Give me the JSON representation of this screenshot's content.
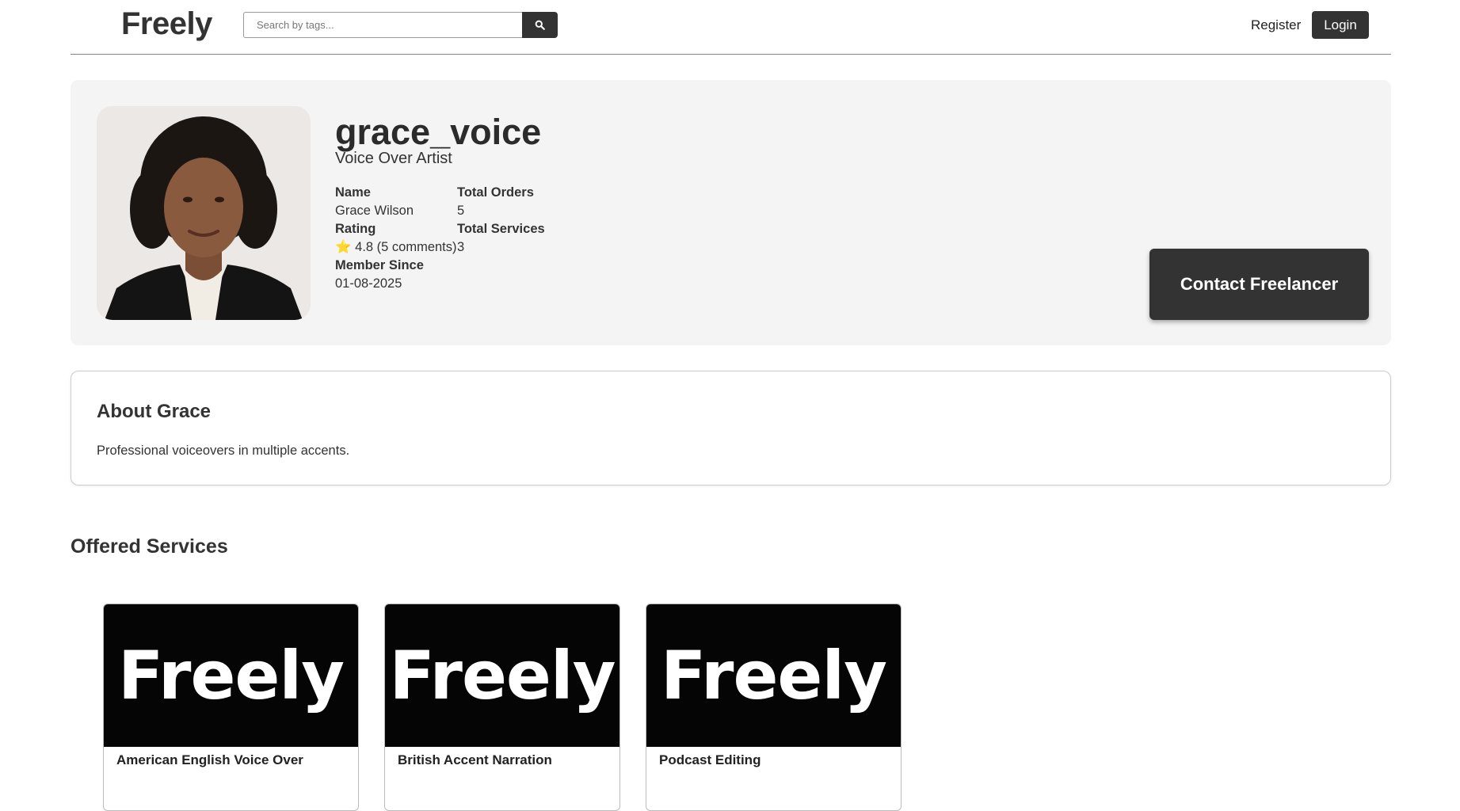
{
  "header": {
    "logo": "Freely",
    "search_placeholder": "Search by tags...",
    "register_label": "Register",
    "login_label": "Login"
  },
  "profile": {
    "username": "grace_voice",
    "title": "Voice Over Artist",
    "name_label": "Name",
    "name_value": "Grace Wilson",
    "rating_label": "Rating",
    "rating_star": "⭐",
    "rating_value": "4.8 (5 comments)",
    "member_label": "Member Since",
    "member_value": "01-08-2025",
    "orders_label": "Total Orders",
    "orders_value": "5",
    "services_label": "Total Services",
    "services_value": "3",
    "contact_label": "Contact Freelancer"
  },
  "about": {
    "title": "About Grace",
    "text": "Professional voiceovers in multiple accents."
  },
  "services": {
    "title": "Offered Services",
    "items": [
      {
        "image_text": "Freely",
        "title": "American English Voice Over"
      },
      {
        "image_text": "Freely",
        "title": "British Accent Narration"
      },
      {
        "image_text": "Freely",
        "title": "Podcast Editing"
      }
    ]
  }
}
